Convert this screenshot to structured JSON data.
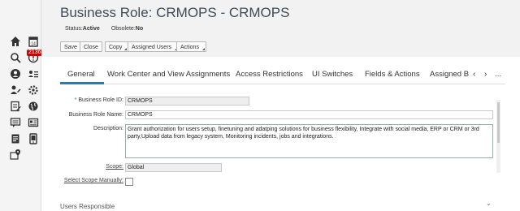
{
  "header": {
    "title": "Business Role: CRMOPS - CRMOPS",
    "status_label": "Status:",
    "status_value": "Active",
    "obsolete_label": "Obsolete:",
    "obsolete_value": "No"
  },
  "toolbar": {
    "save": "Save",
    "close": "Close",
    "copy": "Copy",
    "assigned_users": "Assigned Users",
    "actions": "Actions"
  },
  "tabs": [
    {
      "label": "General"
    },
    {
      "label": "Work Center and View Assignments"
    },
    {
      "label": "Access Restrictions"
    },
    {
      "label": "UI Switches"
    },
    {
      "label": "Fields & Actions"
    },
    {
      "label": "Assigned Bu"
    }
  ],
  "tab_nav": {
    "prev": "‹",
    "next": "›",
    "more": "..."
  },
  "notifications": {
    "count": "2136"
  },
  "form": {
    "required_marker": "*",
    "business_role_id_label": "Business Role ID:",
    "business_role_id": "CRMOPS",
    "business_role_name_label": "Business Role Name:",
    "business_role_name": "CRMOPS",
    "description_label": "Description:",
    "description": "Grant authorization for users setup, finetuning and adatping solutions for business flexibility, Integrate with social media, ERP or CRM or 3rd party,Upload data from legacy system, Monitoring incidents, jobs and integrations.",
    "scope_label": "Scope:",
    "scope": "Global",
    "select_scope_label": "Select Scope Manually:"
  },
  "section": {
    "title": "Users Responsible",
    "chevron": "⌄"
  },
  "icons": [
    "home-icon",
    "calendar-icon",
    "search-icon",
    "alert-icon",
    "user-icon",
    "contacts-icon",
    "person-edit-icon",
    "settings-icon",
    "edit-list-icon",
    "globe-icon",
    "chat-list-icon",
    "id-card-icon",
    "document-icon",
    "tablet-icon",
    "map-pin-icon"
  ],
  "colors": {
    "accent": "#2a7bb0",
    "badge": "#d40000",
    "title": "#3f4b57"
  }
}
